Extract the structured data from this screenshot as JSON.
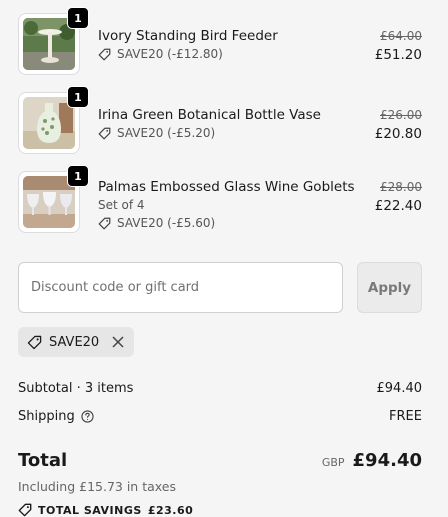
{
  "items": [
    {
      "name": "Ivory Standing Bird Feeder",
      "variant": "",
      "quantity": "1",
      "discount": "SAVE20 (-£12.80)",
      "original_price": "£64.00",
      "price": "£51.20"
    },
    {
      "name": "Irina Green Botanical Bottle Vase",
      "variant": "",
      "quantity": "1",
      "discount": "SAVE20 (-£5.20)",
      "original_price": "£26.00",
      "price": "£20.80"
    },
    {
      "name": "Palmas Embossed Glass Wine Goblets",
      "variant": "Set of 4",
      "quantity": "1",
      "discount": "SAVE20 (-£5.60)",
      "original_price": "£28.00",
      "price": "£22.40"
    }
  ],
  "discount_form": {
    "placeholder": "Discount code or gift card",
    "value": "",
    "apply_label": "Apply"
  },
  "applied_code": {
    "code": "SAVE20"
  },
  "summary": {
    "subtotal_label": "Subtotal · 3 items",
    "subtotal_value": "£94.40",
    "shipping_label": "Shipping",
    "shipping_value": "FREE",
    "total_label": "Total",
    "currency": "GBP",
    "total_value": "£94.40",
    "taxes_note": "Including £15.73 in taxes",
    "savings_label": "TOTAL SAVINGS",
    "savings_value": "£23.60"
  },
  "icons": {
    "tag": "tag-icon",
    "help": "help-circle-icon",
    "remove": "close-icon"
  },
  "colors": {
    "background": "#f5f5f5",
    "text": "#1a1a1a",
    "muted": "#666666",
    "badge": "#000000",
    "chip": "#e6e6e6"
  }
}
